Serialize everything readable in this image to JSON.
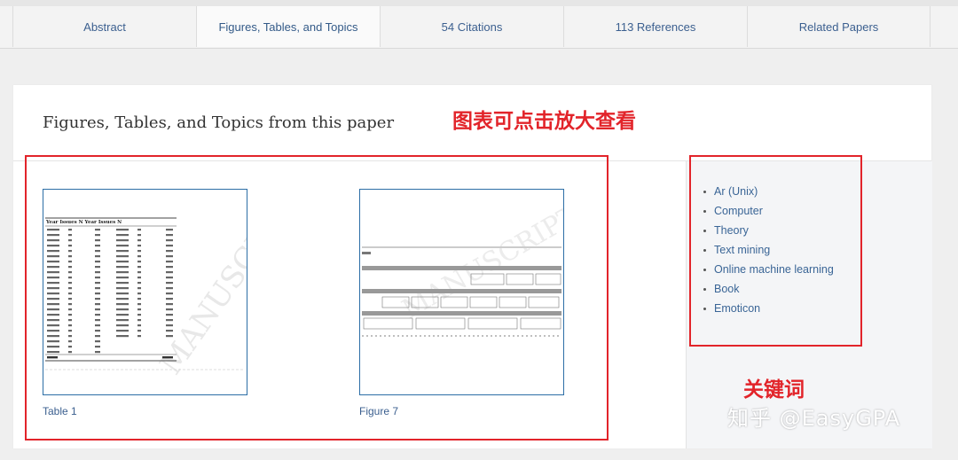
{
  "tabs": [
    {
      "label": "Abstract"
    },
    {
      "label": "Figures, Tables, and Topics",
      "active": true
    },
    {
      "label": "54 Citations"
    },
    {
      "label": "113 References"
    },
    {
      "label": "Related Papers"
    }
  ],
  "section": {
    "title": "Figures, Tables, and Topics from this paper"
  },
  "figures": [
    {
      "caption": "Table 1"
    },
    {
      "caption": "Figure 7"
    }
  ],
  "topics": [
    "Ar (Unix)",
    "Computer",
    "Theory",
    "Text mining",
    "Online machine learning",
    "Book",
    "Emoticon"
  ],
  "annotations": {
    "figures_note": "图表可点击放大查看",
    "keywords_note": "关键词"
  },
  "watermark": "知乎 @EasyGPA",
  "colors": {
    "link": "#3b5f8f",
    "annotation": "#e2242a",
    "thumb_border": "#2c6ea6"
  }
}
